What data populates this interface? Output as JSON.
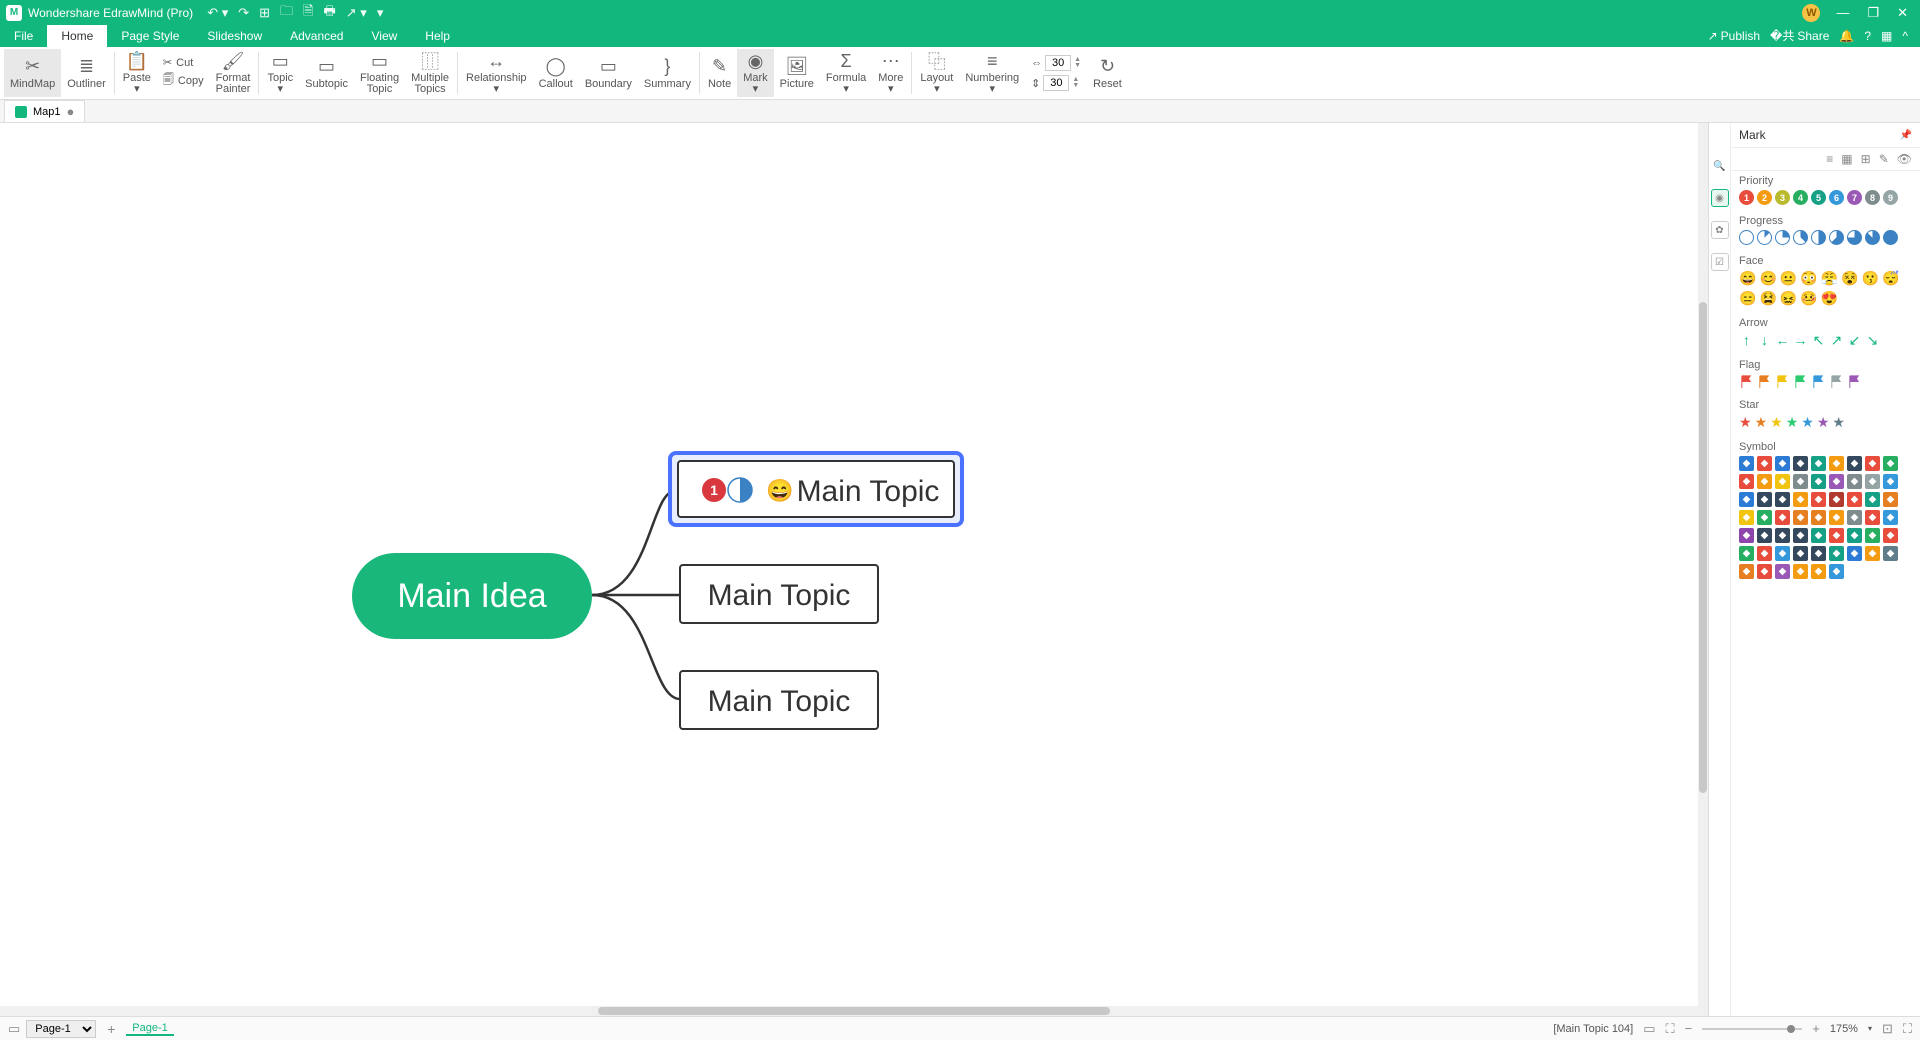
{
  "app": {
    "title": "Wondershare EdrawMind (Pro)"
  },
  "menu": {
    "items": [
      "File",
      "Home",
      "Page Style",
      "Slideshow",
      "Advanced",
      "View",
      "Help"
    ],
    "active": 1,
    "right": {
      "publish": "Publish",
      "share": "Share"
    }
  },
  "ribbon": {
    "mindmap": "MindMap",
    "outliner": "Outliner",
    "paste": "Paste",
    "cut": "Cut",
    "copy": "Copy",
    "format_painter": "Format\nPainter",
    "topic": "Topic",
    "subtopic": "Subtopic",
    "floating": "Floating\nTopic",
    "multiple": "Multiple\nTopics",
    "relationship": "Relationship",
    "callout": "Callout",
    "boundary": "Boundary",
    "summary": "Summary",
    "note": "Note",
    "mark": "Mark",
    "picture": "Picture",
    "formula": "Formula",
    "more": "More",
    "layout": "Layout",
    "numbering": "Numbering",
    "width": "30",
    "height": "30",
    "reset": "Reset"
  },
  "doc": {
    "tab": "Map1"
  },
  "mind": {
    "root": "Main Idea",
    "topic1": "Main Topic",
    "topic2": "Main Topic",
    "topic3": "Main Topic"
  },
  "panel": {
    "title": "Mark",
    "priority": {
      "title": "Priority",
      "colors": [
        "#e74c3c",
        "#f39c12",
        "#baba2e",
        "#27ae60",
        "#16a085",
        "#3498db",
        "#9b59b6",
        "#7f8c8d",
        "#95a5a6"
      ]
    },
    "progress": {
      "title": "Progress"
    },
    "face": {
      "title": "Face",
      "items": [
        "😄",
        "😊",
        "😐",
        "😳",
        "😤",
        "😵",
        "😗",
        "😴",
        "😑",
        "😫",
        "😖",
        "🤒",
        "😍"
      ]
    },
    "arrow": {
      "title": "Arrow",
      "items": [
        "↑",
        "↓",
        "←",
        "→",
        "↖",
        "↗",
        "↙",
        "↘"
      ]
    },
    "flag": {
      "title": "Flag",
      "colors": [
        "#e74c3c",
        "#e67e22",
        "#f1c40f",
        "#2ecc71",
        "#3498db",
        "#95a5a6",
        "#9b59b6"
      ]
    },
    "star": {
      "title": "Star",
      "colors": [
        "#e74c3c",
        "#e67e22",
        "#f1c40f",
        "#2ecc71",
        "#3498db",
        "#9b59b6",
        "#607d8b"
      ]
    },
    "symbol": {
      "title": "Symbol",
      "grid_colors": [
        "#2c7bd4",
        "#e74c3c",
        "#2c7bd4",
        "#34495e",
        "#16a085",
        "#f39c12",
        "#34495e",
        "#e74c3c",
        "#27ae60",
        "#e74c3c",
        "#f39c12",
        "#f1c40f",
        "#7f8c8d",
        "#16a085",
        "#9b59b6",
        "#7f8c8d",
        "#95a5a6",
        "#3498db",
        "#2c7bd4",
        "#34495e",
        "#34495e",
        "#f39c12",
        "#e74c3c",
        "#b03a2e",
        "#e74c3c",
        "#16a085",
        "#e67e22",
        "#f1c40f",
        "#27ae60",
        "#e74c3c",
        "#e67e22",
        "#e67e22",
        "#f39c12",
        "#7f8c8d",
        "#e74c3c",
        "#3498db",
        "#8e44ad",
        "#34495e",
        "#34495e",
        "#34495e",
        "#16a085",
        "#e74c3c",
        "#16a085",
        "#27ae60",
        "#e74c3c",
        "#27ae60",
        "#e74c3c",
        "#3498db",
        "#34495e",
        "#34495e",
        "#16a085",
        "#2c7bd4",
        "#f39c12",
        "#607d8b",
        "#e67e22",
        "#e74c3c",
        "#9b59b6",
        "#f39c12",
        "#f39c12",
        "#3498db"
      ]
    }
  },
  "status": {
    "page_sel": "Page-1",
    "page_tab": "Page-1",
    "info": "[Main Topic 104]",
    "zoom": "175%"
  }
}
